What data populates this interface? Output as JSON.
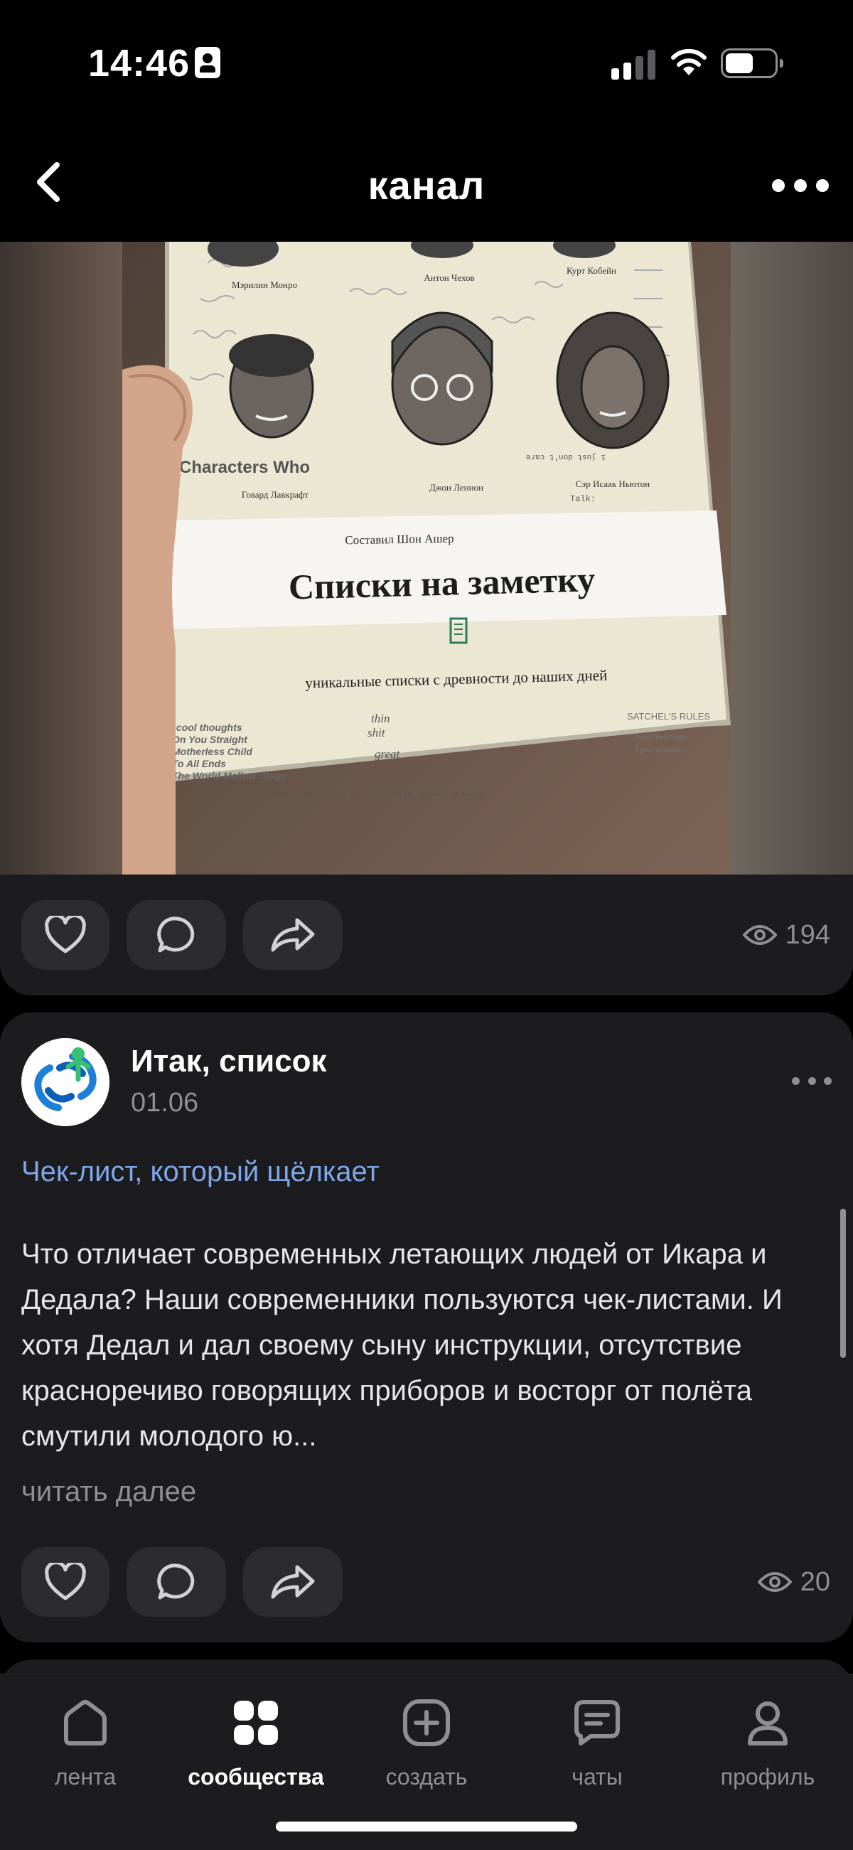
{
  "status_bar": {
    "time": "14:46",
    "icons": [
      "id-card-icon",
      "cellular-signal-icon",
      "wifi-icon",
      "battery-icon"
    ]
  },
  "header": {
    "title": "канал",
    "back_icon": "chevron-left-icon",
    "more_icon": "more-horizontal-icon"
  },
  "media_post": {
    "image": {
      "book_compiler": "Составил Шон Ашер",
      "book_title": "Списки на заметку",
      "book_subtitle": "уникальные списки с древности до наших дней",
      "portrait_names": [
        "Мэрилин Монро",
        "Антон Чехов",
        "Курт Кобейн",
        "Говард Лавкрафт",
        "Джон Леннон",
        "Сэр Исаак Ньютон"
      ],
      "cover_snippets": [
        "Characters Who",
        "SATCHEL'S RULES",
        "Avoid fried foods",
        "If your stomach",
        "cool thoughts",
        "On You Straight",
        "Motherless Child",
        "To All Ends",
        "The World Mellow Stage",
        "thin",
        "shit",
        "great",
        "Is there any advice that you can give to the teenagers of today?",
        "1 just don't care",
        "Talk:"
      ]
    },
    "views": "194"
  },
  "post": {
    "author": "Итак, список",
    "date": "01.06",
    "title": "Чек-лист, который щёлкает",
    "body": "Что отличает современных летающих людей от Икара и Дедала? Наши современники пользуются чек-листами. И хотя Дедал и дал своему сыну инструкции, отсутствие красноречиво говорящих приборов и восторг от полёта смутили молодого ю...",
    "read_more": "читать далее",
    "views": "20"
  },
  "actions": {
    "like_icon": "heart-icon",
    "comment_icon": "comment-bubble-icon",
    "share_icon": "share-arrow-icon",
    "views_icon": "eye-icon"
  },
  "tab_bar": {
    "items": [
      {
        "label": "лента",
        "icon": "home-icon",
        "active": false
      },
      {
        "label": "сообщества",
        "icon": "grid-icon",
        "active": true
      },
      {
        "label": "создать",
        "icon": "plus-square-icon",
        "active": false
      },
      {
        "label": "чаты",
        "icon": "chat-icon",
        "active": false
      },
      {
        "label": "профиль",
        "icon": "person-icon",
        "active": false
      }
    ]
  },
  "colors": {
    "background": "#000000",
    "card": "#1c1c1e",
    "button": "#2c2c2e",
    "accent_link": "#7ea6ea",
    "muted": "#8e8e93"
  }
}
